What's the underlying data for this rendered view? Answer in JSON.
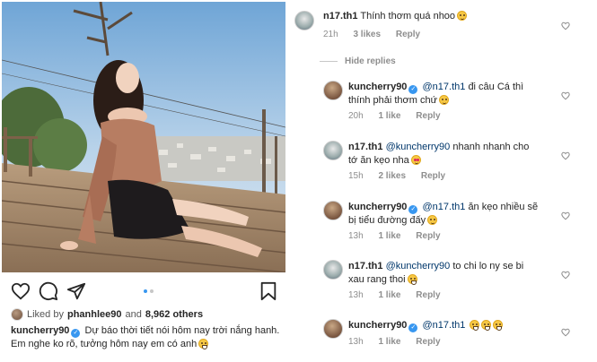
{
  "post": {
    "image_alt": "woman in off-shoulder ruffled blouse sitting on wooden deck above hillside town",
    "carousel": {
      "count": 2,
      "active": 0
    },
    "likes": {
      "prefix": "Liked by",
      "user": "phanhlee90",
      "and": "and",
      "count_text": "8,962 others"
    },
    "caption": {
      "username": "kuncherry90",
      "line1": "Dự báo thời tiết nói hôm nay trời nắng hanh.",
      "line2": "Em nghe ko rõ, tưởng hôm nay em có anh"
    },
    "icons": [
      "heart-icon",
      "comment-icon",
      "share-icon",
      "bookmark-icon"
    ]
  },
  "comments": {
    "top": {
      "username": "n17.th1",
      "text": "Thính thơm quá nhoo",
      "time": "21h",
      "likes": "3 likes",
      "reply": "Reply"
    },
    "hide_replies": "Hide replies",
    "replies": [
      {
        "username": "kuncherry90",
        "verified": true,
        "mention": "@n17.th1",
        "text_line1": "đi câu Cá thì",
        "text_line2": "thính phải thơm chứ",
        "time": "20h",
        "likes": "1 like",
        "reply": "Reply"
      },
      {
        "username": "n17.th1",
        "verified": false,
        "mention": "@kuncherry90",
        "text_line1": "nhanh nhanh cho",
        "text_line2": "tớ ăn kẹo nha",
        "time": "15h",
        "likes": "2 likes",
        "reply": "Reply"
      },
      {
        "username": "kuncherry90",
        "verified": true,
        "mention": "@n17.th1",
        "text_line1": "ăn kẹo nhiều sẽ",
        "text_line2": "bị tiểu đường đấy",
        "time": "13h",
        "likes": "1 like",
        "reply": "Reply"
      },
      {
        "username": "n17.th1",
        "verified": false,
        "mention": "@kuncherry90",
        "text_line1": "to chi lo ny se bi",
        "text_line2": "xau rang thoi",
        "time": "13h",
        "likes": "1 like",
        "reply": "Reply"
      },
      {
        "username": "kuncherry90",
        "verified": true,
        "mention": "@n17.th1",
        "text_line1": "",
        "text_line2": "",
        "time": "13h",
        "likes": "1 like",
        "reply": "Reply"
      }
    ]
  },
  "colors": {
    "verified": "#3897f0",
    "muted": "#8e8e8e",
    "active_dot": "#3897f0",
    "inactive_dot": "#c7c7c7"
  }
}
